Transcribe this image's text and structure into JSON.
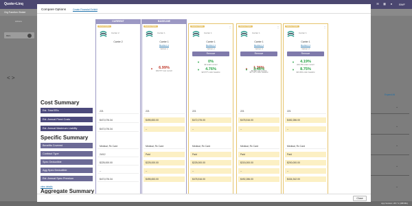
{
  "app": {
    "logo": "Quote+Linq",
    "user": "BWF",
    "org_function": "Org Function: Broker",
    "actions_label": "Actions",
    "chip_label": "REG",
    "nav_arrows": "< >",
    "expand_all": "Expand All",
    "version": "App Version: 28.7.1 (3fff1f6b)"
  },
  "modal": {
    "title": "Compare Options",
    "create_link": "Create Financial Exhibit",
    "close_label": "Close",
    "view_details": "view details"
  },
  "sections": {
    "cost": "Cost Summary",
    "specific": "Specific Summary",
    "aggregate": "Aggregate Summary"
  },
  "row_labels": {
    "cost": [
      "Est. Total EEs",
      "Est. Annual Fixed Costs",
      "Est. Annual Maximum Liability"
    ],
    "specific": [
      "Benefits Covered",
      "Contract Type",
      "Spec Deductible",
      "Agg Spec Deductible",
      "Est. Annual Spec Premium"
    ]
  },
  "columns": [
    {
      "header": "CURRENT",
      "tag": "Current Option",
      "carrier_small": "Carrier 2",
      "carrier": "Carrier 2",
      "revision": "",
      "option": "",
      "remove": "",
      "stat1": "",
      "stat1_sub": "",
      "stat2": "",
      "stat2_sub": "",
      "values": [
        "221",
        "$472,076.34",
        "",
        "$472,076.34",
        "Medical, Rx Card",
        "24/12",
        "$225,000.00",
        "--",
        "$472,076.34"
      ]
    },
    {
      "header": "BASELINE",
      "tag": "Selected Option",
      "carrier_small": "Carrier 1",
      "carrier": "Carrier 1",
      "revision": "Revision 1",
      "option": "Option 1",
      "remove": "",
      "stat1": "6.99%",
      "stat1_sub": "$33,577 over current",
      "stat2": "",
      "stat2_sub": "",
      "values": [
        "221",
        "$495,653.00",
        "",
        "--",
        "Medical, Rx Card",
        "Paid",
        "$225,000.00",
        "--",
        "$495,653.00"
      ]
    },
    {
      "header": "",
      "tag": "Selected Option",
      "carrier_small": "Carrier 1",
      "carrier": "Carrier 1",
      "revision": "Revision 1",
      "option": "Option 2",
      "remove": "Remove",
      "stat1": "0%",
      "stat1_sub": "$0 under current",
      "stat2": "4.76%",
      "stat2_sub": "$23,577 under baseline",
      "values": [
        "221",
        "$472,076.00",
        "",
        "--",
        "Medical, Rx Card",
        "Paid",
        "$225,000.00",
        "--",
        "$478,516.00"
      ]
    },
    {
      "header": "",
      "tag": "Selected Option",
      "carrier_small": "Carrier 1",
      "carrier": "Carrier 1",
      "revision": "Revision 1",
      "option": "Option 3",
      "remove": "Remove",
      "stat1": "1.36%",
      "stat1_sub": "$6,440 over current",
      "stat2": "3.46%",
      "stat2_sub": "$17,137 under baseline",
      "values": [
        "221",
        "$478,516.00",
        "",
        "--",
        "Medical, Rx Card",
        "Paid",
        "$215,000.00",
        "--",
        "$492,286.00"
      ]
    },
    {
      "header": "",
      "tag": "Selected Option",
      "carrier_small": "Carrier 1",
      "carrier": "Carrier 1",
      "revision": "Revision 1",
      "option": "Option 4",
      "remove": "Remove",
      "stat1": "4.19%",
      "stat1_sub": "$19,786 under current",
      "stat2": "8.75%",
      "stat2_sub": "$43,363 under baseline",
      "values": [
        "221",
        "$452,286.00",
        "",
        "--",
        "Medical, Rx Card",
        "Paid",
        "$200,000.00",
        "--",
        "$434,342.00"
      ]
    }
  ]
}
